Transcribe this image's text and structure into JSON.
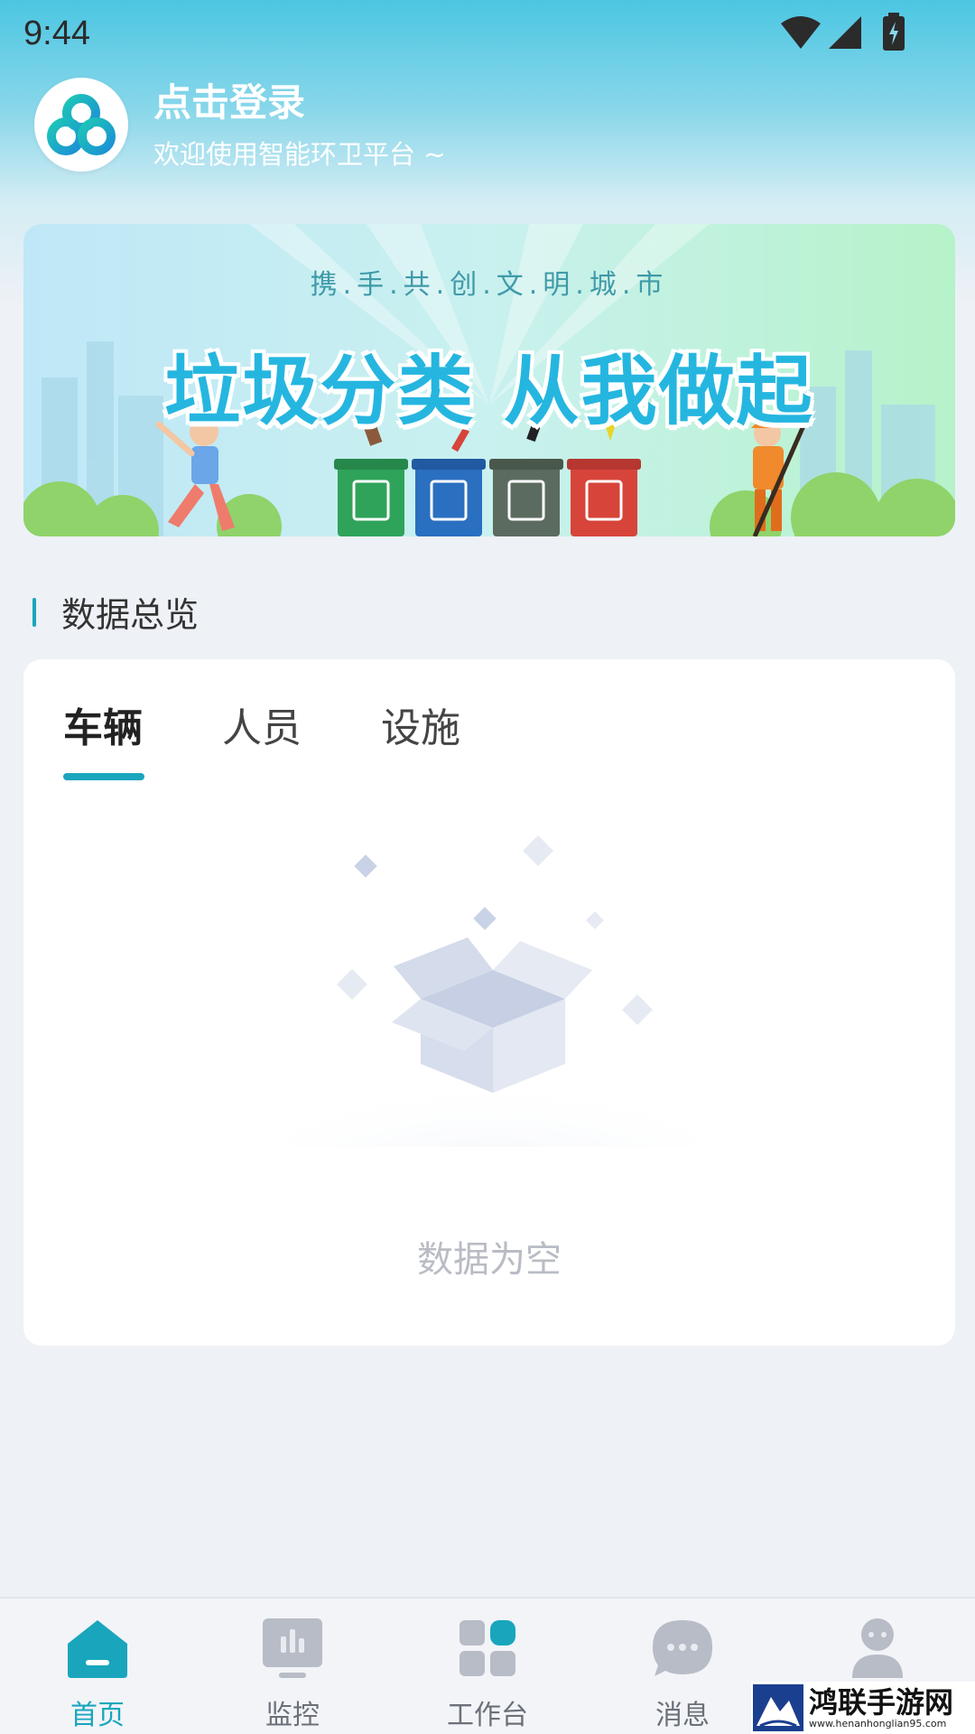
{
  "status_bar": {
    "time": "9:44"
  },
  "profile": {
    "title": "点击登录",
    "subtitle": "欢迎使用智能环卫平台 ~"
  },
  "banner": {
    "subtitle": "携.手.共.创.文.明.城.市",
    "title": "垃圾分类  从我做起"
  },
  "section": {
    "title": "数据总览"
  },
  "card": {
    "tabs": [
      {
        "label": "车辆",
        "active": true
      },
      {
        "label": "人员",
        "active": false
      },
      {
        "label": "设施",
        "active": false
      }
    ],
    "empty_text": "数据为空"
  },
  "tabbar": {
    "items": [
      {
        "label": "首页",
        "icon": "home-icon",
        "active": true
      },
      {
        "label": "监控",
        "icon": "monitor-icon",
        "active": false
      },
      {
        "label": "工作台",
        "icon": "workbench-icon",
        "active": false
      },
      {
        "label": "消息",
        "icon": "message-icon",
        "active": false
      },
      {
        "label": "",
        "icon": "profile-icon",
        "active": false
      }
    ]
  },
  "watermark": {
    "main": "鸿联手游网",
    "sub": "www.henanhonglian95.com"
  },
  "colors": {
    "accent": "#19a6bd",
    "header": "#4cc6e2",
    "background": "#eef1f6"
  }
}
